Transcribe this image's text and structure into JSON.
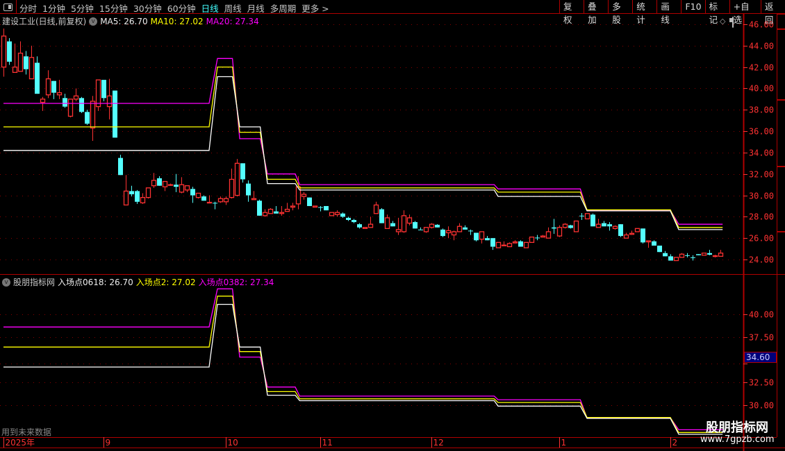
{
  "toolbar": {
    "periods": [
      "分时",
      "1分钟",
      "5分钟",
      "15分钟",
      "30分钟",
      "60分钟",
      "日线",
      "周线",
      "月线",
      "多周期",
      "更多 >"
    ],
    "active_period": "日线",
    "buttons": [
      "复权",
      "叠加",
      "多股",
      "统计",
      "画线",
      "F10",
      "标记",
      "+自选",
      "返回"
    ]
  },
  "main_panel": {
    "title": "建设工业(日线,前复权)",
    "ma5": "MA5: 26.70",
    "ma10": "MA10: 27.02",
    "ma20": "MA20: 27.34",
    "y_ticks": [
      "46.00",
      "44.00",
      "42.00",
      "40.00",
      "38.00",
      "36.00",
      "34.00",
      "32.00",
      "30.00",
      "28.00",
      "26.00",
      "24.00"
    ]
  },
  "indicator_panel": {
    "title": "股朋指标网",
    "line1": "入场点0618: 26.70",
    "line2": "入场点2: 27.02",
    "line3": "入场点0382: 27.34",
    "y_ticks": [
      "40.00",
      "37.50",
      "32.50",
      "30.00"
    ],
    "cursor_price": "34.60",
    "note": "用到未来数据"
  },
  "date_axis": [
    {
      "label": "2025年",
      "index": 0
    },
    {
      "label": "9",
      "index": 18
    },
    {
      "label": "10",
      "index": 40
    },
    {
      "label": "11",
      "index": 57
    },
    {
      "label": "12",
      "index": 77
    },
    {
      "label": "1",
      "index": 100
    },
    {
      "label": "2",
      "index": 120
    }
  ],
  "watermark": {
    "name": "股朋指标网",
    "url": "www.7gpzb.com"
  },
  "colors": {
    "up": "#ff3232",
    "down": "#54ffff",
    "ma5": "#ffffff",
    "ma10": "#ffff00",
    "ma20": "#ff00ff",
    "axis": "#ff3232",
    "grid": "#8b0000"
  },
  "chart_data": {
    "type": "candlestick",
    "ohlc": [
      [
        42.0,
        45.6,
        41.1,
        44.9
      ],
      [
        44.4,
        44.7,
        42.2,
        42.5
      ],
      [
        41.5,
        44.2,
        41.5,
        42.0
      ],
      [
        41.6,
        44.4,
        41.6,
        43.3
      ],
      [
        43.0,
        43.5,
        41.3,
        41.8
      ],
      [
        40.9,
        44.0,
        40.9,
        42.9
      ],
      [
        42.4,
        43.0,
        39.5,
        39.5
      ],
      [
        38.7,
        39.2,
        37.9,
        39.0
      ],
      [
        39.4,
        41.7,
        39.1,
        40.9
      ],
      [
        40.7,
        40.7,
        39.0,
        39.6
      ],
      [
        39.4,
        40.8,
        39.0,
        39.6
      ],
      [
        39.1,
        39.5,
        38.2,
        38.3
      ],
      [
        37.4,
        39.0,
        37.3,
        39.0
      ],
      [
        39.0,
        40.0,
        38.8,
        39.3
      ],
      [
        39.1,
        39.2,
        37.7,
        37.8
      ],
      [
        37.8,
        38.0,
        36.6,
        36.7
      ],
      [
        36.3,
        39.3,
        35.1,
        38.8
      ],
      [
        38.3,
        40.8,
        37.9,
        40.8
      ],
      [
        40.8,
        40.8,
        38.8,
        39.1
      ],
      [
        38.3,
        40.9,
        37.1,
        39.3
      ],
      [
        39.8,
        39.8,
        35.4,
        35.4
      ],
      [
        33.5,
        33.8,
        31.9,
        31.9
      ],
      [
        29.1,
        31.9,
        29.1,
        30.4
      ],
      [
        30.4,
        30.9,
        29.9,
        30.1
      ],
      [
        30.4,
        30.5,
        29.2,
        29.4
      ],
      [
        29.3,
        30.2,
        29.2,
        29.8
      ],
      [
        29.8,
        30.7,
        29.7,
        30.7
      ],
      [
        30.9,
        32.1,
        30.7,
        31.4
      ],
      [
        31.6,
        31.8,
        30.9,
        30.9
      ],
      [
        30.8,
        31.3,
        30.4,
        31.3
      ],
      [
        30.95,
        31.1,
        30.9,
        31.0
      ],
      [
        31.0,
        32.0,
        30.3,
        30.8
      ],
      [
        30.3,
        31.7,
        30.2,
        31.0
      ],
      [
        30.5,
        30.9,
        30.3,
        30.9
      ],
      [
        30.6,
        30.8,
        29.3,
        30.0
      ],
      [
        29.8,
        30.2,
        29.7,
        30.2
      ],
      [
        29.9,
        30.0,
        29.5,
        29.5
      ],
      [
        29.3,
        30.0,
        29.3,
        29.35
      ],
      [
        29.3,
        29.4,
        28.7,
        29.25
      ],
      [
        29.4,
        29.9,
        29.3,
        29.7
      ],
      [
        29.4,
        29.9,
        29.1,
        29.7
      ],
      [
        29.8,
        32.5,
        29.7,
        31.5
      ],
      [
        30.0,
        33.4,
        29.9,
        33.0
      ],
      [
        33.0,
        33.0,
        31.2,
        31.5
      ],
      [
        31.1,
        31.4,
        29.4,
        30.0
      ],
      [
        29.6,
        30.4,
        29.6,
        29.7
      ],
      [
        29.5,
        29.6,
        28.1,
        28.1
      ],
      [
        28.1,
        28.7,
        28.0,
        28.4
      ],
      [
        28.3,
        28.8,
        28.3,
        28.7
      ],
      [
        28.5,
        29.0,
        28.3,
        28.3
      ],
      [
        28.3,
        29.0,
        28.1,
        28.4
      ],
      [
        28.5,
        29.3,
        28.5,
        28.7
      ],
      [
        28.9,
        29.3,
        28.6,
        29.0
      ],
      [
        29.2,
        31.8,
        28.7,
        30.8
      ],
      [
        29.9,
        30.3,
        29.6,
        30.1
      ],
      [
        29.8,
        29.8,
        29.0,
        29.0
      ],
      [
        28.9,
        29.0,
        28.9,
        29.0
      ],
      [
        28.9,
        29.0,
        28.5,
        28.85
      ],
      [
        29.0,
        29.0,
        28.6,
        28.6
      ],
      [
        28.1,
        28.4,
        28.1,
        28.4
      ],
      [
        28.2,
        28.6,
        28.0,
        28.4
      ],
      [
        28.3,
        28.4,
        27.9,
        28.0
      ],
      [
        27.9,
        28.0,
        27.6,
        27.7
      ],
      [
        27.7,
        27.8,
        27.4,
        27.5
      ],
      [
        27.3,
        27.4,
        26.9,
        27.0
      ],
      [
        26.9,
        27.0,
        26.9,
        27.0
      ],
      [
        27.0,
        28.0,
        27.0,
        27.3
      ],
      [
        28.3,
        29.4,
        28.3,
        29.1
      ],
      [
        28.7,
        28.8,
        27.4,
        27.4
      ],
      [
        26.9,
        28.2,
        26.9,
        27.9
      ],
      [
        27.4,
        27.6,
        27.1,
        27.1
      ],
      [
        26.6,
        27.9,
        26.3,
        26.8
      ],
      [
        26.6,
        28.6,
        26.5,
        28.1
      ],
      [
        27.4,
        28.2,
        27.2,
        27.9
      ],
      [
        27.5,
        27.6,
        26.9,
        26.9
      ],
      [
        26.8,
        27.0,
        26.8,
        26.75
      ],
      [
        26.6,
        27.0,
        26.5,
        27.0
      ],
      [
        27.0,
        27.4,
        26.9,
        27.3
      ],
      [
        27.25,
        27.3,
        27.0,
        27.0
      ],
      [
        26.8,
        26.9,
        26.1,
        26.2
      ],
      [
        26.5,
        27.1,
        26.0,
        26.7
      ],
      [
        26.3,
        26.7,
        25.8,
        26.6
      ],
      [
        26.6,
        27.4,
        26.6,
        27.1
      ],
      [
        27.0,
        27.2,
        26.8,
        26.8
      ],
      [
        26.7,
        26.8,
        26.3,
        26.65
      ],
      [
        26.5,
        26.5,
        25.7,
        25.8
      ],
      [
        25.9,
        26.6,
        25.5,
        26.6
      ],
      [
        26.0,
        26.2,
        25.8,
        25.8
      ],
      [
        26.0,
        26.0,
        24.9,
        25.2
      ],
      [
        25.1,
        25.6,
        25.1,
        25.6
      ],
      [
        25.3,
        25.7,
        25.3,
        25.35
      ],
      [
        25.2,
        25.6,
        25.2,
        25.5
      ],
      [
        25.55,
        25.8,
        25.5,
        25.65
      ],
      [
        25.7,
        25.8,
        25.2,
        25.2
      ],
      [
        25.1,
        25.6,
        25.1,
        25.6
      ],
      [
        25.6,
        26.1,
        25.6,
        26.1
      ],
      [
        26.05,
        26.3,
        25.8,
        26.0
      ],
      [
        26.1,
        26.3,
        26.1,
        26.2
      ],
      [
        26.0,
        27.0,
        26.0,
        26.6
      ],
      [
        27.0,
        27.8,
        26.4,
        26.9
      ],
      [
        26.2,
        27.2,
        26.1,
        27.0
      ],
      [
        27.0,
        27.4,
        26.9,
        27.3
      ],
      [
        27.2,
        27.25,
        26.9,
        26.95
      ],
      [
        26.6,
        27.6,
        26.6,
        27.6
      ],
      [
        28.1,
        28.35,
        27.7,
        28.05
      ],
      [
        27.8,
        28.3,
        27.8,
        28.3
      ],
      [
        28.2,
        28.3,
        27.1,
        27.1
      ],
      [
        27.0,
        27.8,
        27.0,
        27.3
      ],
      [
        27.4,
        27.6,
        27.1,
        27.1
      ],
      [
        27.3,
        27.5,
        26.7,
        27.1
      ],
      [
        26.9,
        27.2,
        26.8,
        27.1
      ],
      [
        27.3,
        27.3,
        26.1,
        26.2
      ],
      [
        26.0,
        26.5,
        26.0,
        26.3
      ],
      [
        26.35,
        26.7,
        26.3,
        26.45
      ],
      [
        26.6,
        26.9,
        26.6,
        26.9
      ],
      [
        26.9,
        26.9,
        25.5,
        25.6
      ],
      [
        25.65,
        25.75,
        25.1,
        25.75
      ],
      [
        25.7,
        25.8,
        25.3,
        25.3
      ],
      [
        25.3,
        25.3,
        24.7,
        24.7
      ],
      [
        24.6,
        24.8,
        24.3,
        24.3
      ],
      [
        24.3,
        24.5,
        23.9,
        23.9
      ],
      [
        23.9,
        24.2,
        23.9,
        24.2
      ],
      [
        24.2,
        24.6,
        24.2,
        24.5
      ],
      [
        24.4,
        24.6,
        24.2,
        24.35
      ],
      [
        24.2,
        24.4,
        23.9,
        24.15
      ],
      [
        24.5,
        24.5,
        24.4,
        24.4
      ],
      [
        24.4,
        24.6,
        24.4,
        24.6
      ],
      [
        24.6,
        24.9,
        24.4,
        24.45
      ],
      [
        24.3,
        24.45,
        24.2,
        24.35
      ],
      [
        24.3,
        24.9,
        24.3,
        24.6
      ]
    ],
    "lines": [
      {
        "name": "MA20 / 入场点0382",
        "color": "#ff00ff",
        "points": [
          [
            0,
            38.6
          ],
          [
            37,
            38.6
          ],
          [
            38.5,
            42.8
          ],
          [
            41.2,
            42.8
          ],
          [
            42.5,
            35.3
          ],
          [
            46.2,
            35.3
          ],
          [
            47.5,
            32.0
          ],
          [
            52.5,
            32.0
          ],
          [
            53.3,
            31.0
          ],
          [
            88.3,
            31.0
          ],
          [
            89,
            30.6
          ],
          [
            103.8,
            30.6
          ],
          [
            105,
            28.6
          ],
          [
            120,
            28.6
          ],
          [
            121.5,
            27.3
          ],
          [
            129.4,
            27.3
          ]
        ]
      },
      {
        "name": "MA10 / 入场点2",
        "color": "#ffff00",
        "points": [
          [
            0,
            36.4
          ],
          [
            37,
            36.4
          ],
          [
            38.5,
            42.0
          ],
          [
            41.2,
            42.0
          ],
          [
            42.5,
            35.9
          ],
          [
            46.2,
            35.9
          ],
          [
            47.5,
            31.5
          ],
          [
            52.5,
            31.5
          ],
          [
            53.3,
            30.7
          ],
          [
            88.3,
            30.7
          ],
          [
            89,
            30.3
          ],
          [
            103.8,
            30.3
          ],
          [
            105,
            28.65
          ],
          [
            120,
            28.65
          ],
          [
            121.5,
            27.0
          ],
          [
            129.4,
            27.0
          ]
        ]
      },
      {
        "name": "MA5 / 入场点0618",
        "color": "#ffffff",
        "points": [
          [
            0,
            34.2
          ],
          [
            37,
            34.2
          ],
          [
            38.5,
            41.1
          ],
          [
            41.2,
            41.1
          ],
          [
            42.5,
            36.4
          ],
          [
            46.2,
            36.4
          ],
          [
            47.5,
            31.1
          ],
          [
            52.5,
            31.1
          ],
          [
            53.3,
            30.5
          ],
          [
            88.3,
            30.5
          ],
          [
            89,
            29.9
          ],
          [
            103.8,
            29.9
          ],
          [
            105,
            28.55
          ],
          [
            120,
            28.55
          ],
          [
            121.5,
            26.8
          ],
          [
            129.4,
            26.8
          ]
        ]
      }
    ],
    "main_ylim": [
      24,
      46
    ],
    "indicator_ylim": [
      30,
      40
    ]
  }
}
